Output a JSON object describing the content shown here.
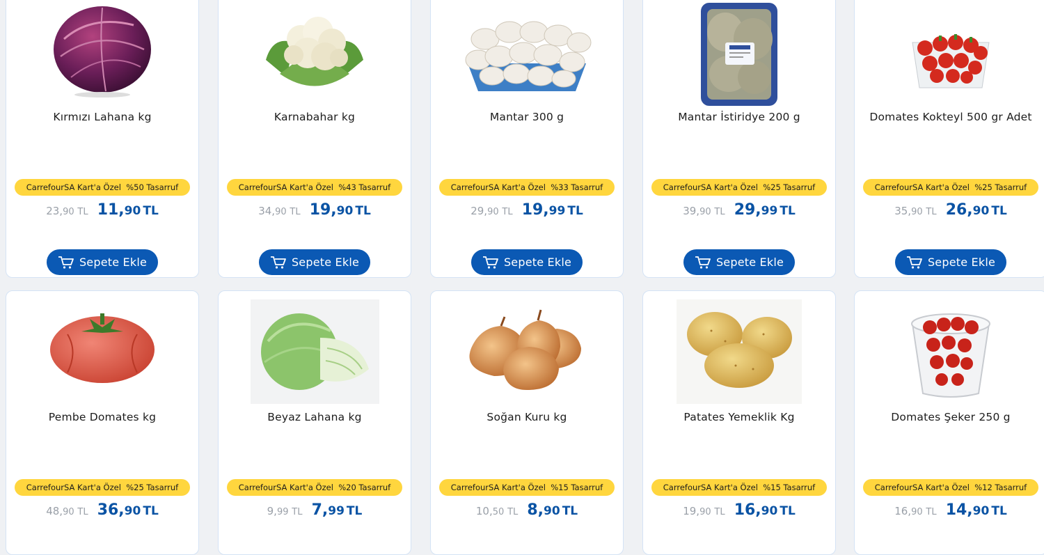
{
  "accent_color": "#0b59b4",
  "badge_color": "#ffd63e",
  "products": [
    {
      "name": "Kırmızı Lahana kg",
      "badge": "CarrefourSA Kart'a Özel  %50 Tasarruf",
      "old_int": "23,",
      "old_dec": "90",
      "new_int": "11,",
      "new_dec": "90",
      "currency": "TL",
      "button": "Sepete Ekle",
      "icon": "red-cabbage-image"
    },
    {
      "name": "Karnabahar kg",
      "badge": "CarrefourSA Kart'a Özel  %43 Tasarruf",
      "old_int": "34,",
      "old_dec": "90",
      "new_int": "19,",
      "new_dec": "90",
      "currency": "TL",
      "button": "Sepete Ekle",
      "icon": "cauliflower-image"
    },
    {
      "name": "Mantar 300 g",
      "badge": "CarrefourSA Kart'a Özel  %33 Tasarruf",
      "old_int": "29,",
      "old_dec": "90",
      "new_int": "19,",
      "new_dec": "99",
      "currency": "TL",
      "button": "Sepete Ekle",
      "icon": "mushroom-tray-image"
    },
    {
      "name": "Mantar İstiridye 200 g",
      "badge": "CarrefourSA Kart'a Özel  %25 Tasarruf",
      "old_int": "39,",
      "old_dec": "90",
      "new_int": "29,",
      "new_dec": "99",
      "currency": "TL",
      "button": "Sepete Ekle",
      "icon": "oyster-mushroom-pack-image"
    },
    {
      "name": "Domates Kokteyl 500 gr Adet",
      "badge": "CarrefourSA Kart'a Özel  %25 Tasarruf",
      "old_int": "35,",
      "old_dec": "90",
      "new_int": "26,",
      "new_dec": "90",
      "currency": "TL",
      "button": "Sepete Ekle",
      "icon": "cocktail-tomato-image"
    },
    {
      "name": "Pembe Domates kg",
      "badge": "CarrefourSA Kart'a Özel  %25 Tasarruf",
      "old_int": "48,",
      "old_dec": "90",
      "new_int": "36,",
      "new_dec": "90",
      "currency": "TL",
      "button": "Sepete Ekle",
      "icon": "pink-tomato-image"
    },
    {
      "name": "Beyaz Lahana kg",
      "badge": "CarrefourSA Kart'a Özel  %20 Tasarruf",
      "old_int": "9,",
      "old_dec": "99",
      "new_int": "7,",
      "new_dec": "99",
      "currency": "TL",
      "button": "Sepete Ekle",
      "icon": "white-cabbage-image"
    },
    {
      "name": "Soğan Kuru kg",
      "badge": "CarrefourSA Kart'a Özel  %15 Tasarruf",
      "old_int": "10,",
      "old_dec": "50",
      "new_int": "8,",
      "new_dec": "90",
      "currency": "TL",
      "button": "Sepete Ekle",
      "icon": "onion-image"
    },
    {
      "name": "Patates Yemeklik Kg",
      "badge": "CarrefourSA Kart'a Özel  %15 Tasarruf",
      "old_int": "19,",
      "old_dec": "90",
      "new_int": "16,",
      "new_dec": "90",
      "currency": "TL",
      "button": "Sepete Ekle",
      "icon": "potato-image"
    },
    {
      "name": "Domates Şeker 250 g",
      "badge": "CarrefourSA Kart'a Özel  %12 Tasarruf",
      "old_int": "16,",
      "old_dec": "90",
      "new_int": "14,",
      "new_dec": "90",
      "currency": "TL",
      "button": "Sepete Ekle",
      "icon": "cherry-tomato-cup-image"
    }
  ]
}
